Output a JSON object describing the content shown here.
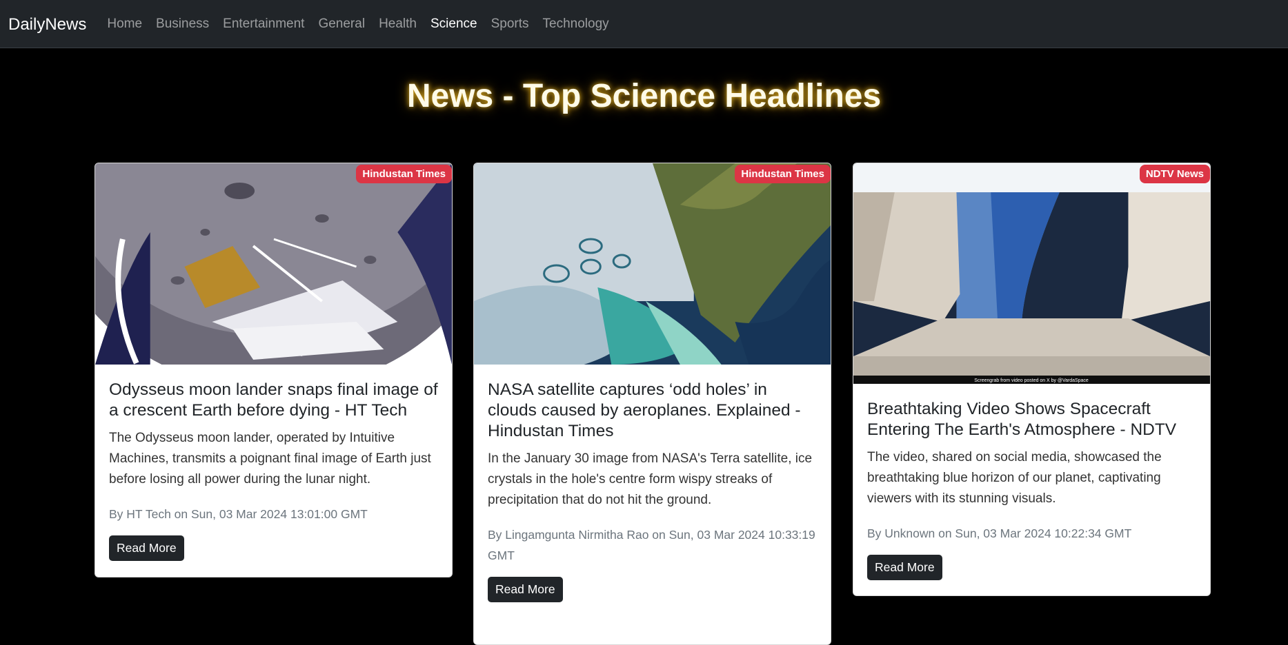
{
  "navbar": {
    "brand": "DailyNews",
    "links": [
      {
        "label": "Home"
      },
      {
        "label": "Business"
      },
      {
        "label": "Entertainment"
      },
      {
        "label": "General"
      },
      {
        "label": "Health"
      },
      {
        "label": "Science",
        "active": true
      },
      {
        "label": "Sports"
      },
      {
        "label": "Technology"
      }
    ]
  },
  "heading": "News - Top Science Headlines",
  "cards": [
    {
      "source": "Hindustan Times",
      "title": "Odysseus moon lander snaps final image of a crescent Earth before dying - HT Tech",
      "description": "The Odysseus moon lander, operated by Intuitive Machines, transmits a poignant final image of Earth just before losing all power during the lunar night.",
      "meta": "By HT Tech on Sun, 03 Mar 2024 13:01:00 GMT",
      "button": "Read More"
    },
    {
      "source": "Hindustan Times",
      "title": "NASA satellite captures ‘odd holes’ in clouds caused by aeroplanes. Explained - Hindustan Times",
      "description": "In the January 30 image from NASA's Terra satellite, ice crystals in the hole's centre form wispy streaks of precipitation that do not hit the ground.",
      "meta": "By Lingamgunta Nirmitha Rao on Sun, 03 Mar 2024 10:33:19 GMT",
      "button": "Read More"
    },
    {
      "source": "NDTV News",
      "title": "Breathtaking Video Shows Spacecraft Entering The Earth's Atmosphere - NDTV",
      "description": "The video, shared on social media, showcased the breathtaking blue horizon of our planet, captivating viewers with its stunning visuals.",
      "meta": "By Unknown on Sun, 03 Mar 2024 10:22:34 GMT",
      "button": "Read More",
      "image_caption": "Screengrab from video posted on X by @VardaSpace"
    }
  ]
}
